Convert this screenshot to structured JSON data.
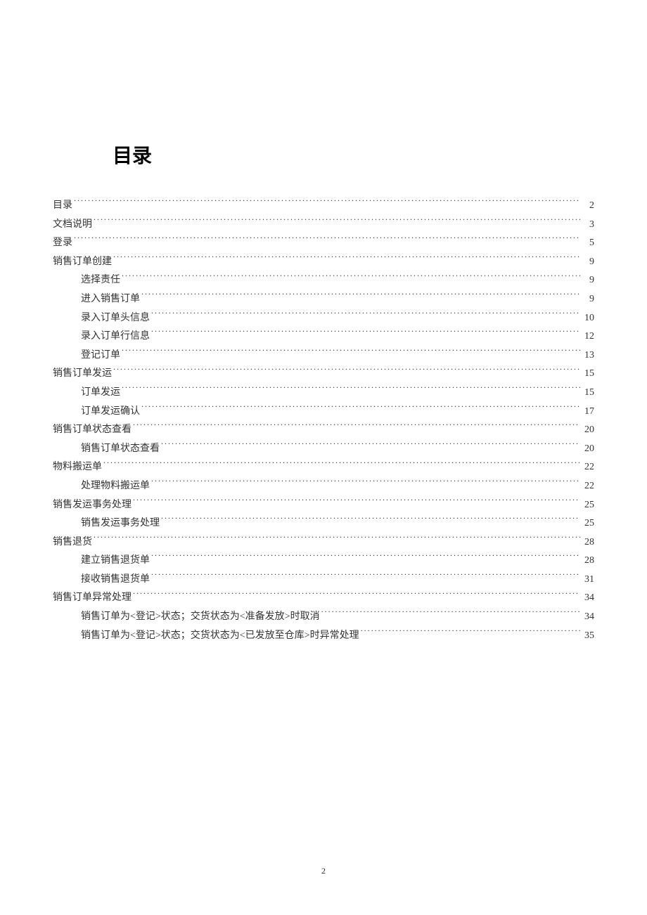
{
  "title": "目录",
  "page_number": "2",
  "toc": [
    {
      "level": 1,
      "label": "目录",
      "page": "2"
    },
    {
      "level": 1,
      "label": "文档说明",
      "page": "3"
    },
    {
      "level": 1,
      "label": "登录",
      "page": "5"
    },
    {
      "level": 1,
      "label": "销售订单创建",
      "page": "9"
    },
    {
      "level": 2,
      "label": "选择责任",
      "page": "9"
    },
    {
      "level": 2,
      "label": "进入销售订单",
      "page": "9"
    },
    {
      "level": 2,
      "label": "录入订单头信息",
      "page": "10"
    },
    {
      "level": 2,
      "label": "录入订单行信息",
      "page": "12"
    },
    {
      "level": 2,
      "label": "登记订单",
      "page": "13"
    },
    {
      "level": 1,
      "label": "销售订单发运",
      "page": "15"
    },
    {
      "level": 2,
      "label": "订单发运",
      "page": "15"
    },
    {
      "level": 2,
      "label": "订单发运确认",
      "page": "17"
    },
    {
      "level": 1,
      "label": "销售订单状态查看",
      "page": "20"
    },
    {
      "level": 2,
      "label": "销售订单状态查看",
      "page": "20"
    },
    {
      "level": 1,
      "label": "物料搬运单",
      "page": "22"
    },
    {
      "level": 2,
      "label": "处理物料搬运单",
      "page": "22"
    },
    {
      "level": 1,
      "label": "销售发运事务处理",
      "page": "25"
    },
    {
      "level": 2,
      "label": "销售发运事务处理",
      "page": "25"
    },
    {
      "level": 1,
      "label": "销售退货",
      "page": "28"
    },
    {
      "level": 2,
      "label": "建立销售退货单",
      "page": "28"
    },
    {
      "level": 2,
      "label": "接收销售退货单",
      "page": "31"
    },
    {
      "level": 1,
      "label": "销售订单异常处理",
      "page": "34"
    },
    {
      "level": 2,
      "label": "销售订单为<登记>状态；交货状态为<准备发放>时取消",
      "page": "34"
    },
    {
      "level": 2,
      "label": "销售订单为<登记>状态；交货状态为<已发放至仓库>时异常处理",
      "page": "35"
    }
  ]
}
